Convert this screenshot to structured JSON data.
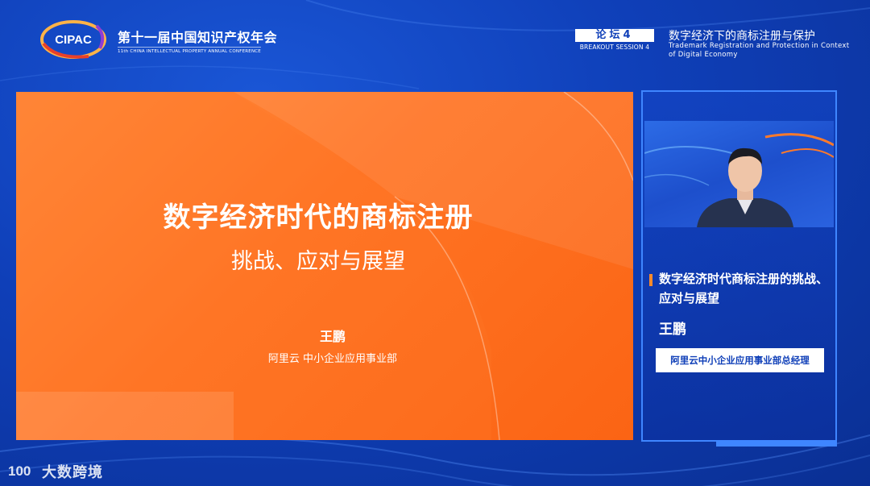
{
  "header": {
    "logo_text": "CIPAC",
    "conference_title": "第十一届中国知识产权年会",
    "conference_subtitle": "11th CHINA INTELLECTUAL PROPERTY ANNUAL CONFERENCE",
    "session_label": "论坛4",
    "session_label_en": "BREAKOUT SESSION 4",
    "session_title": "数字经济下的商标注册与保护",
    "session_title_en": "Trademark Registration and Protection in Context of Digital Economy"
  },
  "slide": {
    "title": "数字经济时代的商标注册",
    "subtitle": "挑战、应对与展望",
    "speaker": "王鹏",
    "department": "阿里云 中小企业应用事业部"
  },
  "panel": {
    "talk_title": "数字经济时代商标注册的挑战、应对与展望",
    "speaker_name": "王鹏",
    "speaker_role": "阿里云中小企业应用事业部总经理"
  },
  "watermark": {
    "logo_text": "100",
    "text": "大数跨境"
  },
  "colors": {
    "background": "#0f3fb8",
    "slide_orange": "#ff7424",
    "accent_bar": "#ff8a2a",
    "panel_border": "#3f86ff"
  }
}
